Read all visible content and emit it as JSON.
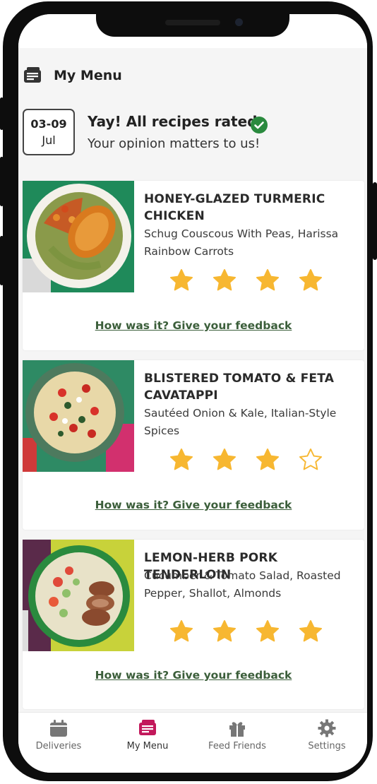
{
  "header": {
    "title": "My Menu",
    "icon": "menu-card-icon"
  },
  "rated": {
    "date_range": "03-09",
    "date_month": "Jul",
    "title": "Yay! All recipes rated",
    "subtitle": "Your opinion matters to us!",
    "status_color": "#2a8a3e"
  },
  "recipes": [
    {
      "title": "HONEY-GLAZED TURMERIC CHICKEN",
      "subtitle": "Schug Couscous With Peas, Harissa Rainbow Carrots",
      "rating": 4,
      "max_rating": 4,
      "feedback": "How was it? Give your feedback"
    },
    {
      "title": "BLISTERED TOMATO & FETA CAVATAPPI",
      "subtitle": "Sautéed Onion & Kale, Italian-Style Spices",
      "rating": 3,
      "max_rating": 4,
      "feedback": "How was it? Give your feedback"
    },
    {
      "title": "LEMON-HERB PORK TENDERLOIN",
      "subtitle": "Cucumber & Tomato Salad, Roasted Pepper, Shallot, Almonds",
      "rating": 4,
      "max_rating": 4,
      "feedback": "How was it? Give your feedback"
    }
  ],
  "tabs": [
    {
      "label": "Deliveries",
      "icon": "calendar-icon",
      "active": false
    },
    {
      "label": "My Menu",
      "icon": "menu-card-icon",
      "active": true
    },
    {
      "label": "Feed Friends",
      "icon": "gift-icon",
      "active": false
    },
    {
      "label": "Settings",
      "icon": "gear-icon",
      "active": false
    }
  ],
  "colors": {
    "star": "#f7b731",
    "link": "#3b5e3a",
    "active_tab": "#c2185b",
    "inactive_tab": "#777777"
  }
}
